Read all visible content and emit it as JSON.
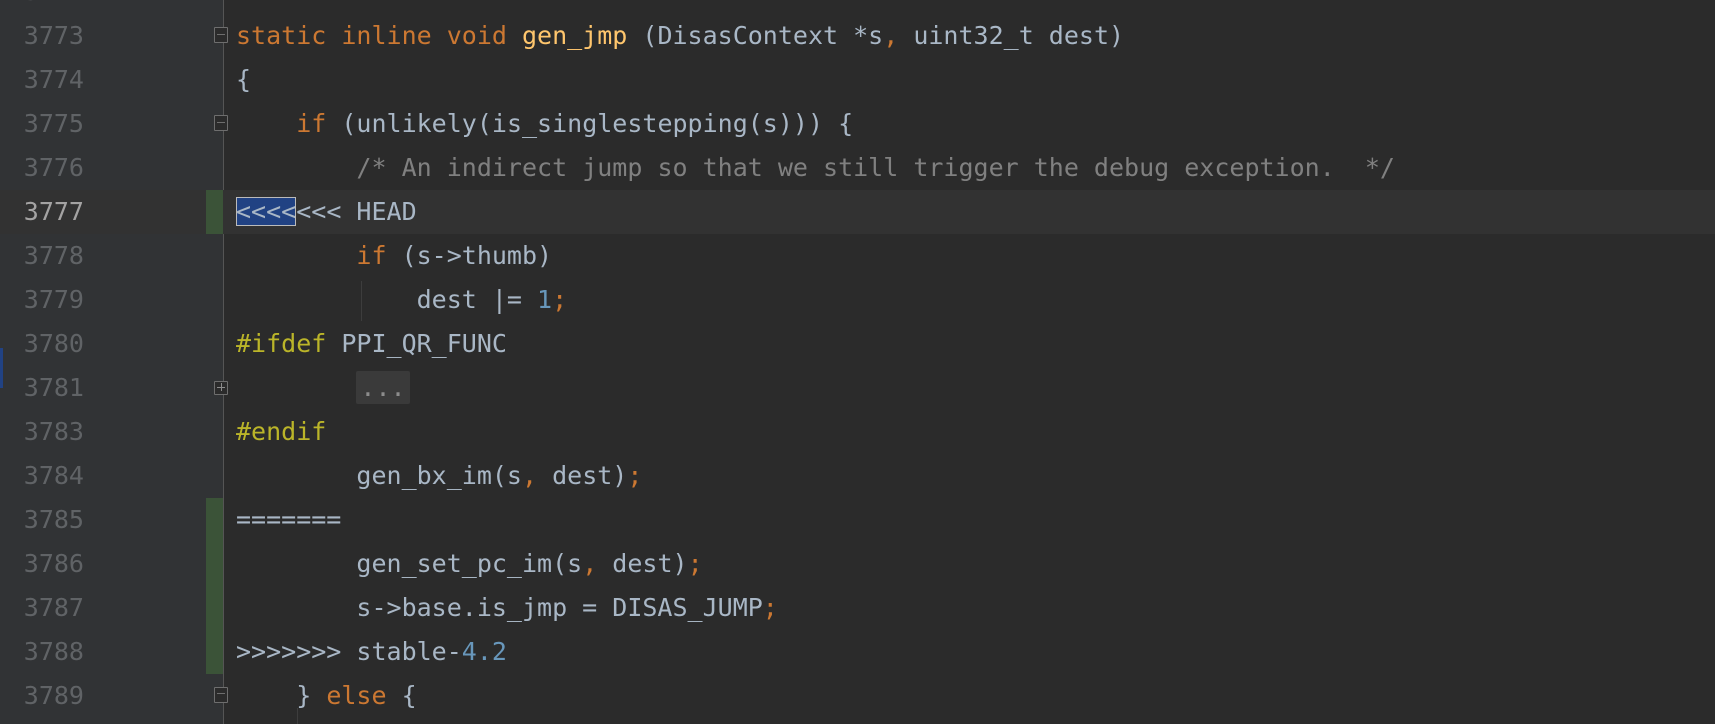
{
  "editor": {
    "partial_top_line_number": "3772",
    "lines": [
      {
        "n": "3773",
        "parts": [
          [
            "kw",
            "static "
          ],
          [
            "kw",
            "inline "
          ],
          [
            "kw",
            "void "
          ],
          [
            "fn",
            "gen_jmp"
          ],
          [
            "t",
            " (DisasContext *s"
          ],
          [
            "punct",
            ","
          ],
          [
            "t",
            " uint32_t dest)"
          ]
        ]
      },
      {
        "n": "3774",
        "parts": [
          [
            "t",
            "{"
          ]
        ]
      },
      {
        "n": "3775",
        "parts": [
          [
            "t",
            "    "
          ],
          [
            "kw",
            "if "
          ],
          [
            "t",
            "(unlikely(is_singlestepping(s))) {"
          ]
        ]
      },
      {
        "n": "3776",
        "parts": [
          [
            "t",
            "        "
          ],
          [
            "cm",
            "/* An indirect jump so that we still trigger the debug exception.  */"
          ]
        ]
      },
      {
        "n": "3777",
        "parts": [
          [
            "sel",
            "<<<<"
          ],
          [
            "t",
            "<<< HEAD"
          ]
        ]
      },
      {
        "n": "3778",
        "parts": [
          [
            "t",
            "        "
          ],
          [
            "kw",
            "if "
          ],
          [
            "t",
            "(s->thumb)"
          ]
        ]
      },
      {
        "n": "3779",
        "parts": [
          [
            "t",
            "            dest |= "
          ],
          [
            "num",
            "1"
          ],
          [
            "punct",
            ";"
          ]
        ]
      },
      {
        "n": "3780",
        "parts": [
          [
            "pp",
            "#ifdef "
          ],
          [
            "t",
            "PPI_QR_FUNC"
          ]
        ]
      },
      {
        "n": "3781",
        "parts": [
          [
            "t",
            "        "
          ],
          [
            "folded",
            "..."
          ]
        ]
      },
      {
        "n": "3783",
        "parts": [
          [
            "pp",
            "#endif"
          ]
        ]
      },
      {
        "n": "3784",
        "parts": [
          [
            "t",
            "        gen_bx_im(s"
          ],
          [
            "punct",
            ","
          ],
          [
            "t",
            " dest)"
          ],
          [
            "punct",
            ";"
          ]
        ]
      },
      {
        "n": "3785",
        "parts": [
          [
            "t",
            "======="
          ]
        ]
      },
      {
        "n": "3786",
        "parts": [
          [
            "t",
            "        gen_set_pc_im(s"
          ],
          [
            "punct",
            ","
          ],
          [
            "t",
            " dest)"
          ],
          [
            "punct",
            ";"
          ]
        ]
      },
      {
        "n": "3787",
        "parts": [
          [
            "t",
            "        s->base.is_jmp = DISAS_JUMP"
          ],
          [
            "punct",
            ";"
          ]
        ]
      },
      {
        "n": "3788",
        "parts": [
          [
            "t",
            ">>>>>>> stable-"
          ],
          [
            "num",
            "4.2"
          ]
        ]
      },
      {
        "n": "3789",
        "parts": [
          [
            "t",
            "    } "
          ],
          [
            "kw",
            "else "
          ],
          [
            "t",
            "{"
          ]
        ]
      }
    ]
  },
  "colors": {
    "background": "#2b2b2b",
    "gutter": "#313335",
    "keyword": "#cc7832",
    "function": "#ffc66d",
    "preprocessor": "#bbb529",
    "comment": "#808080",
    "number": "#6897bb",
    "text": "#a9b7c6",
    "selection": "#214283",
    "diff_marker": "#3b5338"
  }
}
